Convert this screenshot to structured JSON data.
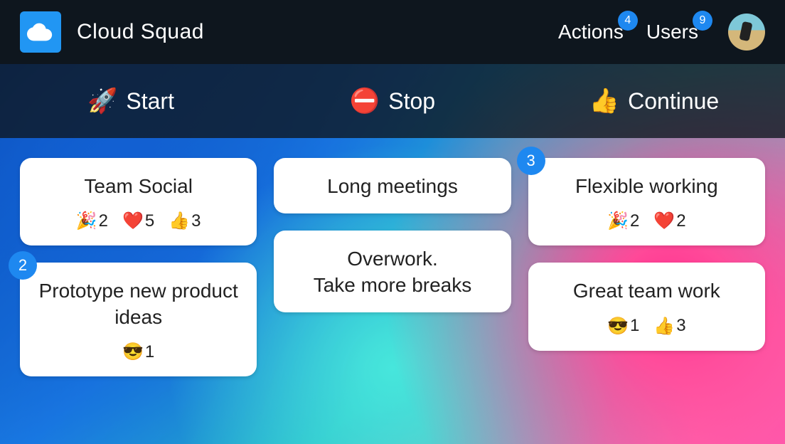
{
  "header": {
    "app_title": "Cloud Squad",
    "nav": {
      "actions": {
        "label": "Actions",
        "badge": "4"
      },
      "users": {
        "label": "Users",
        "badge": "9"
      }
    }
  },
  "tabs": {
    "start": {
      "emoji": "🚀",
      "label": "Start"
    },
    "stop": {
      "emoji": "⛔",
      "label": "Stop"
    },
    "continue": {
      "emoji": "👍",
      "label": "Continue"
    }
  },
  "columns": {
    "start": [
      {
        "title": "Team Social",
        "reactions": [
          {
            "emoji": "🎉",
            "count": "2"
          },
          {
            "emoji": "❤️",
            "count": "5"
          },
          {
            "emoji": "👍",
            "count": "3"
          }
        ]
      },
      {
        "badge": "2",
        "title": "Prototype new product ideas",
        "reactions": [
          {
            "emoji": "😎",
            "count": "1"
          }
        ]
      }
    ],
    "stop": [
      {
        "title": "Long meetings"
      },
      {
        "title": "Overwork.\nTake more breaks"
      }
    ],
    "continue": [
      {
        "badge": "3",
        "title": "Flexible working",
        "reactions": [
          {
            "emoji": "🎉",
            "count": "2"
          },
          {
            "emoji": "❤️",
            "count": "2"
          }
        ]
      },
      {
        "title": "Great team work",
        "reactions": [
          {
            "emoji": "😎",
            "count": "1"
          },
          {
            "emoji": "👍",
            "count": "3"
          }
        ]
      }
    ]
  },
  "colors": {
    "accent": "#1e88f0",
    "header_bg": "#0e161e"
  }
}
